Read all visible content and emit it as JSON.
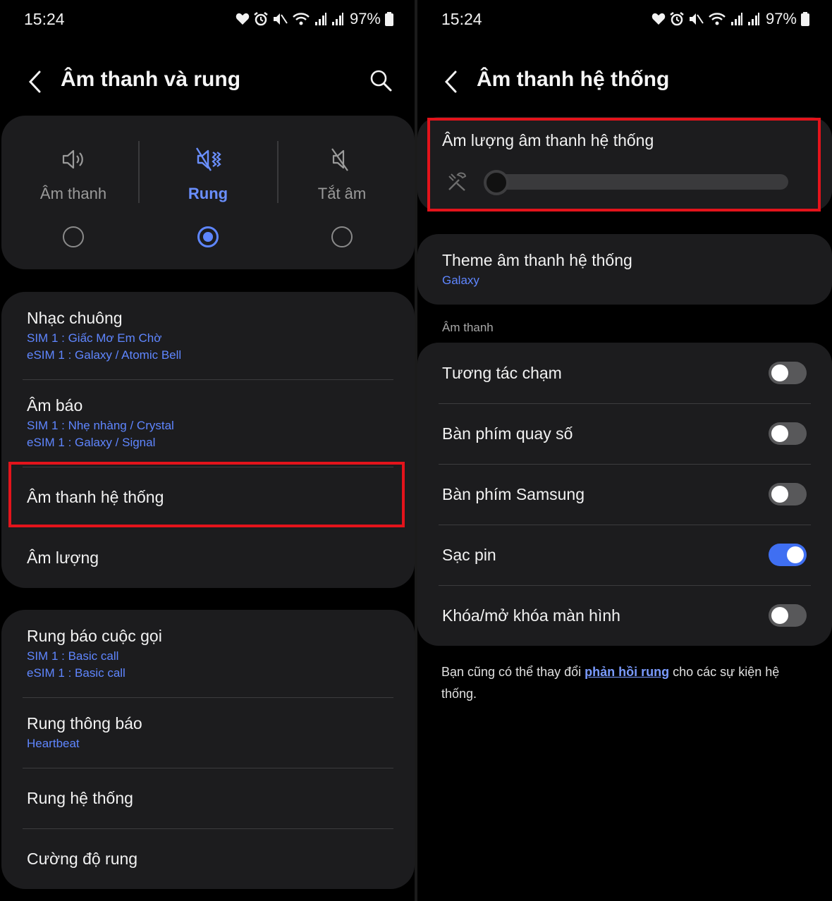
{
  "left": {
    "status": {
      "time": "15:24",
      "battery": "97%"
    },
    "header": {
      "title": "Âm thanh và rung"
    },
    "modes": [
      {
        "label": "Âm thanh",
        "selected": false
      },
      {
        "label": "Rung",
        "selected": true
      },
      {
        "label": "Tắt âm",
        "selected": false
      }
    ],
    "items": [
      {
        "title": "Nhạc chuông",
        "sub1": "SIM 1 : Giấc Mơ Em Chờ",
        "sub2": "eSIM 1 : Galaxy / Atomic Bell"
      },
      {
        "title": "Âm báo",
        "sub1": "SIM 1 : Nhẹ nhàng / Crystal",
        "sub2": "eSIM 1 : Galaxy / Signal"
      },
      {
        "title": "Âm thanh hệ thống"
      },
      {
        "title": "Âm lượng"
      }
    ],
    "vibration": [
      {
        "title": "Rung báo cuộc gọi",
        "sub1": "SIM 1 : Basic call",
        "sub2": "eSIM 1 : Basic call"
      },
      {
        "title": "Rung thông báo",
        "sub1": "Heartbeat"
      },
      {
        "title": "Rung hệ thống"
      },
      {
        "title": "Cường độ rung"
      }
    ]
  },
  "right": {
    "status": {
      "time": "15:24",
      "battery": "97%"
    },
    "header": {
      "title": "Âm thanh hệ thống"
    },
    "volume": {
      "title": "Âm lượng âm thanh hệ thống",
      "level": 0
    },
    "theme": {
      "title": "Theme âm thanh hệ thống",
      "value": "Galaxy"
    },
    "section": "Âm thanh",
    "toggles": [
      {
        "label": "Tương tác chạm",
        "on": false
      },
      {
        "label": "Bàn phím quay số",
        "on": false
      },
      {
        "label": "Bàn phím Samsung",
        "on": false
      },
      {
        "label": "Sạc pin",
        "on": true
      },
      {
        "label": "Khóa/mở khóa màn hình",
        "on": false
      }
    ],
    "note": {
      "before": "Bạn cũng có thể thay đổi ",
      "link": "phản hồi rung",
      "after": " cho các sự kiện hệ thống."
    }
  },
  "colors": {
    "accent": "#5e86ff",
    "highlight": "#e3131b",
    "card": "#1c1c1e"
  }
}
